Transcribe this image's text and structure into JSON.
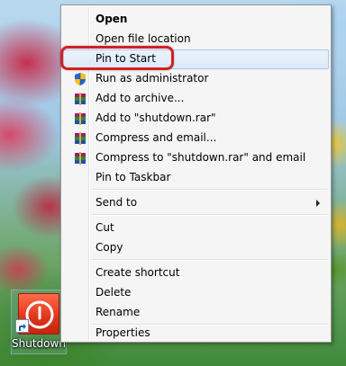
{
  "desktop": {
    "shortcut": {
      "label": "Shutdown",
      "icon": "power-icon"
    }
  },
  "context_menu": {
    "items": {
      "open": "Open",
      "open_file_location": "Open file location",
      "pin_to_start": "Pin to Start",
      "run_as_admin": "Run as administrator",
      "add_to_archive": "Add to archive...",
      "add_to_rar": "Add to \"shutdown.rar\"",
      "compress_email": "Compress and email...",
      "compress_rar_email": "Compress to \"shutdown.rar\" and email",
      "pin_to_taskbar": "Pin to Taskbar",
      "send_to": "Send to",
      "cut": "Cut",
      "copy": "Copy",
      "create_shortcut": "Create shortcut",
      "delete": "Delete",
      "rename": "Rename",
      "properties": "Properties"
    },
    "highlighted_item": "Pin to Start"
  },
  "colors": {
    "highlight_border": "#a8c8ee",
    "callout_red": "#d42020",
    "tile_red": "#e0331b"
  }
}
